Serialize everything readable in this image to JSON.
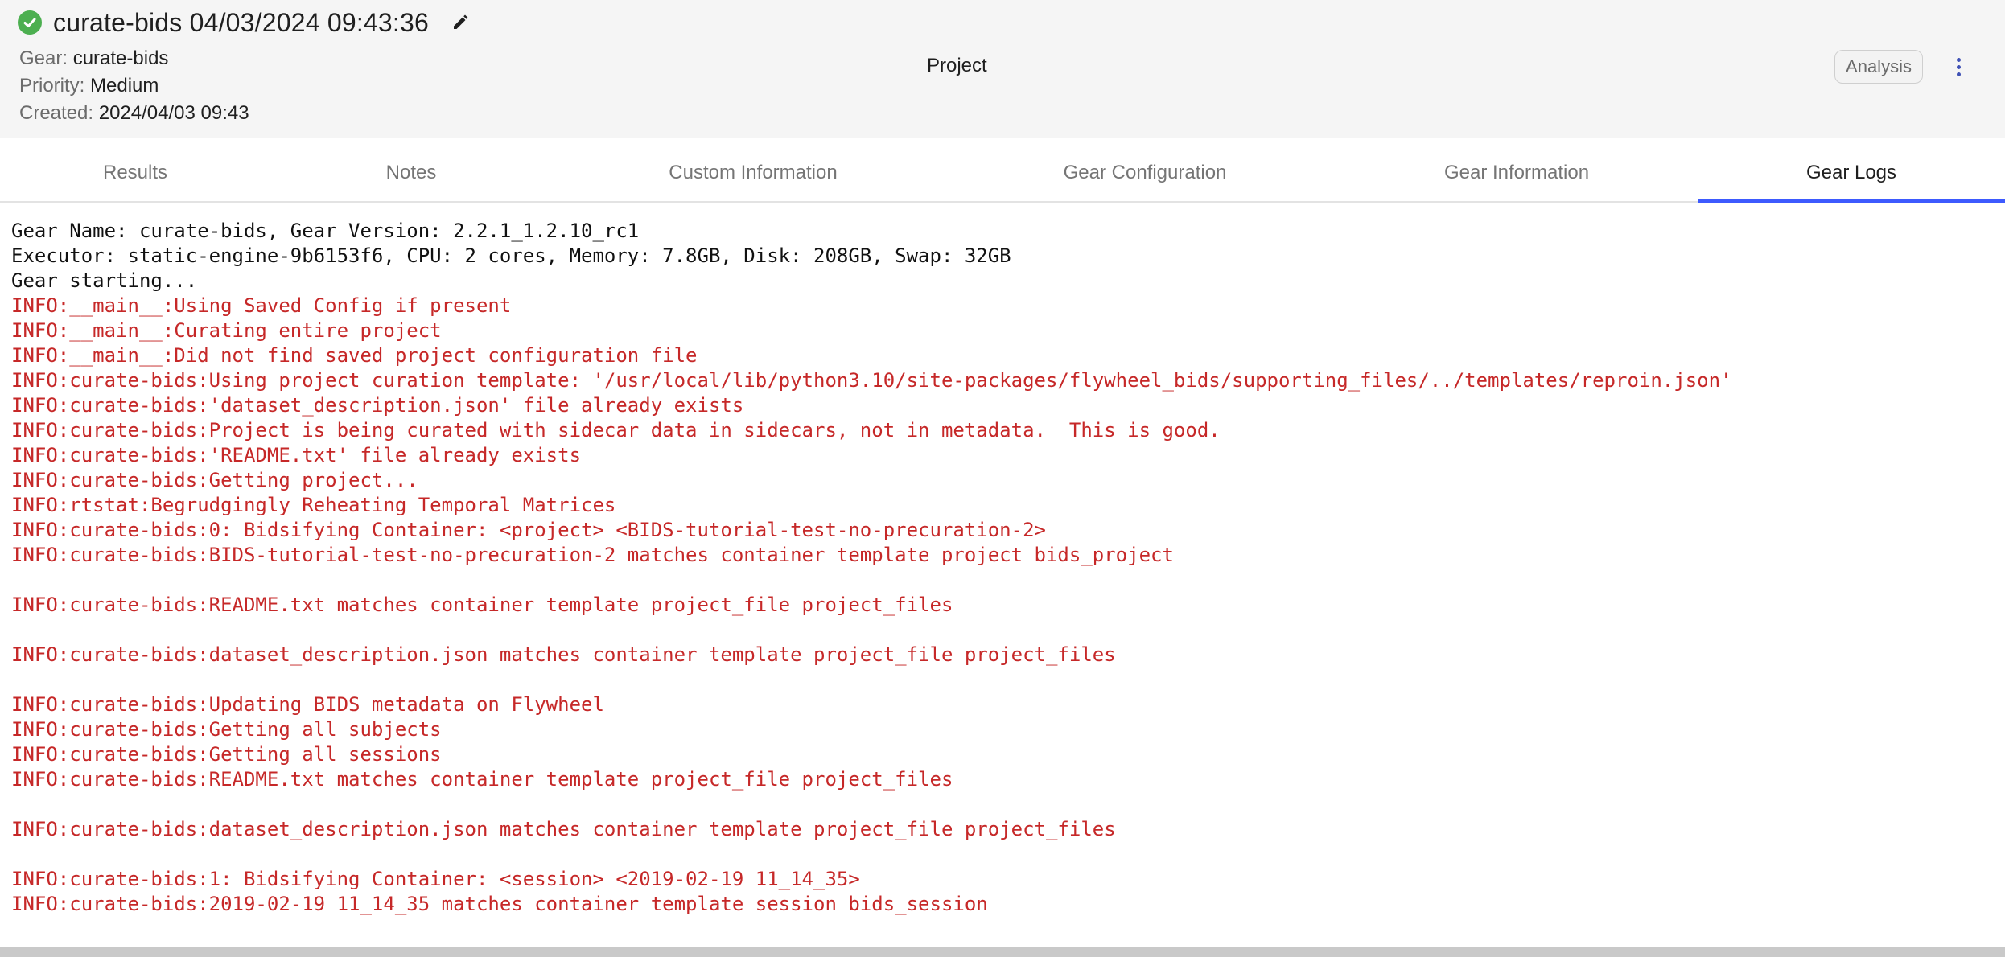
{
  "header": {
    "title": "curate-bids 04/03/2024 09:43:36",
    "status": "success",
    "status_color": "#4caf50",
    "status_icon": "check-circle-icon",
    "edit_icon": "pencil-icon",
    "gear_key": "Gear:",
    "gear_value": "curate-bids",
    "priority_key": "Priority:",
    "priority_value": "Medium",
    "created_key": "Created:",
    "created_value": "2024/04/03 09:43",
    "context_label": "Project",
    "analysis_label": "Analysis",
    "more_icon": "kebab-menu-icon"
  },
  "tabs": [
    {
      "label": "Results",
      "active": false
    },
    {
      "label": "Notes",
      "active": false
    },
    {
      "label": "Custom Information",
      "active": false
    },
    {
      "label": "Gear Configuration",
      "active": false
    },
    {
      "label": "Gear Information",
      "active": false
    },
    {
      "label": "Gear Logs",
      "active": true
    }
  ],
  "accent_color": "#3d5afe",
  "log_colors": {
    "plain": "#111111",
    "info": "#c62828"
  },
  "log_lines": [
    {
      "text": "Gear Name: curate-bids, Gear Version: 2.2.1_1.2.10_rc1",
      "kind": "plain"
    },
    {
      "text": "Executor: static-engine-9b6153f6, CPU: 2 cores, Memory: 7.8GB, Disk: 208GB, Swap: 32GB",
      "kind": "plain"
    },
    {
      "text": "Gear starting...",
      "kind": "plain"
    },
    {
      "text": "INFO:__main__:Using Saved Config if present",
      "kind": "info"
    },
    {
      "text": "INFO:__main__:Curating entire project",
      "kind": "info"
    },
    {
      "text": "INFO:__main__:Did not find saved project configuration file",
      "kind": "info"
    },
    {
      "text": "INFO:curate-bids:Using project curation template: '/usr/local/lib/python3.10/site-packages/flywheel_bids/supporting_files/../templates/reproin.json'",
      "kind": "info"
    },
    {
      "text": "INFO:curate-bids:'dataset_description.json' file already exists",
      "kind": "info"
    },
    {
      "text": "INFO:curate-bids:Project is being curated with sidecar data in sidecars, not in metadata.  This is good.",
      "kind": "info"
    },
    {
      "text": "INFO:curate-bids:'README.txt' file already exists",
      "kind": "info"
    },
    {
      "text": "INFO:curate-bids:Getting project...",
      "kind": "info"
    },
    {
      "text": "INFO:rtstat:Begrudgingly Reheating Temporal Matrices",
      "kind": "info"
    },
    {
      "text": "INFO:curate-bids:0: Bidsifying Container: <project> <BIDS-tutorial-test-no-precuration-2>",
      "kind": "info"
    },
    {
      "text": "INFO:curate-bids:BIDS-tutorial-test-no-precuration-2 matches container template project bids_project",
      "kind": "info"
    },
    {
      "text": "",
      "kind": "info"
    },
    {
      "text": "INFO:curate-bids:README.txt matches container template project_file project_files",
      "kind": "info"
    },
    {
      "text": "",
      "kind": "info"
    },
    {
      "text": "INFO:curate-bids:dataset_description.json matches container template project_file project_files",
      "kind": "info"
    },
    {
      "text": "",
      "kind": "info"
    },
    {
      "text": "INFO:curate-bids:Updating BIDS metadata on Flywheel",
      "kind": "info"
    },
    {
      "text": "INFO:curate-bids:Getting all subjects",
      "kind": "info"
    },
    {
      "text": "INFO:curate-bids:Getting all sessions",
      "kind": "info"
    },
    {
      "text": "INFO:curate-bids:README.txt matches container template project_file project_files",
      "kind": "info"
    },
    {
      "text": "",
      "kind": "info"
    },
    {
      "text": "INFO:curate-bids:dataset_description.json matches container template project_file project_files",
      "kind": "info"
    },
    {
      "text": "",
      "kind": "info"
    },
    {
      "text": "INFO:curate-bids:1: Bidsifying Container: <session> <2019-02-19 11_14_35>",
      "kind": "info"
    },
    {
      "text": "INFO:curate-bids:2019-02-19 11_14_35 matches container template session bids_session",
      "kind": "info"
    }
  ]
}
